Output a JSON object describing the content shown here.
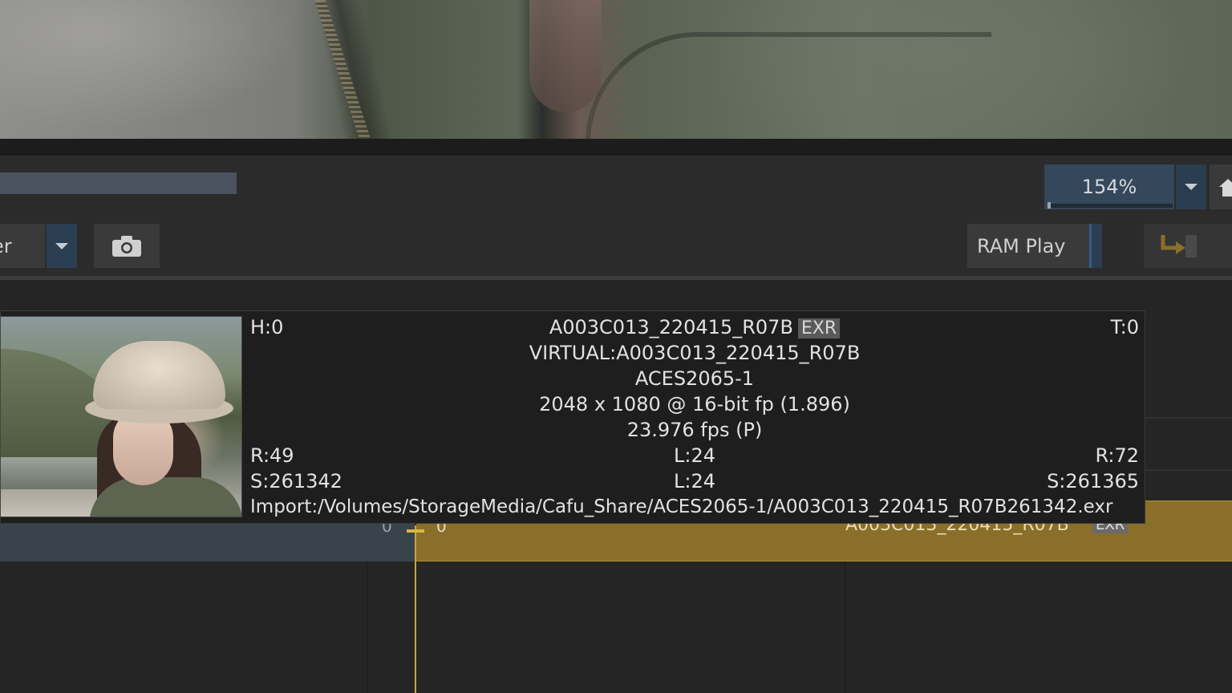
{
  "viewer": {
    "zoom": "154%"
  },
  "toolbar": {
    "mode_label": "er",
    "ram_play_label": "RAM Play"
  },
  "tooltip": {
    "handles_left": "H:0",
    "handles_right": "T:0",
    "clip_name": "A003C013_220415_R07B",
    "clip_format": "EXR",
    "virtual_path": "VIRTUAL:A003C013_220415_R07B",
    "colorspace": "ACES2065-1",
    "resolution": "2048 x 1080 @ 16-bit fp (1.896)",
    "framerate": "23.976 fps (P)",
    "record_in_left": "R:49",
    "length_1": "L:24",
    "record_in_right": "R:72",
    "source_in_left": "S:261342",
    "length_2": "L:24",
    "source_in_right": "S:261365",
    "import_path": "Import:/Volumes/StorageMedia/Cafu_Share/ACES2065-1/A003C013_220415_R07B261342.exr"
  },
  "timeline": {
    "left_clip_frame": "0",
    "right_clip_frame": "0",
    "right_clip_name": "A003C013_220415_R07B",
    "right_clip_format": "EXR"
  },
  "icons": [
    "chevron-down-icon",
    "camera-icon",
    "home-icon",
    "insert-edit-icon"
  ],
  "colors": {
    "accent_blue": "#34475b",
    "clip_gold": "#8a6f2a",
    "playhead": "#c8a838"
  }
}
